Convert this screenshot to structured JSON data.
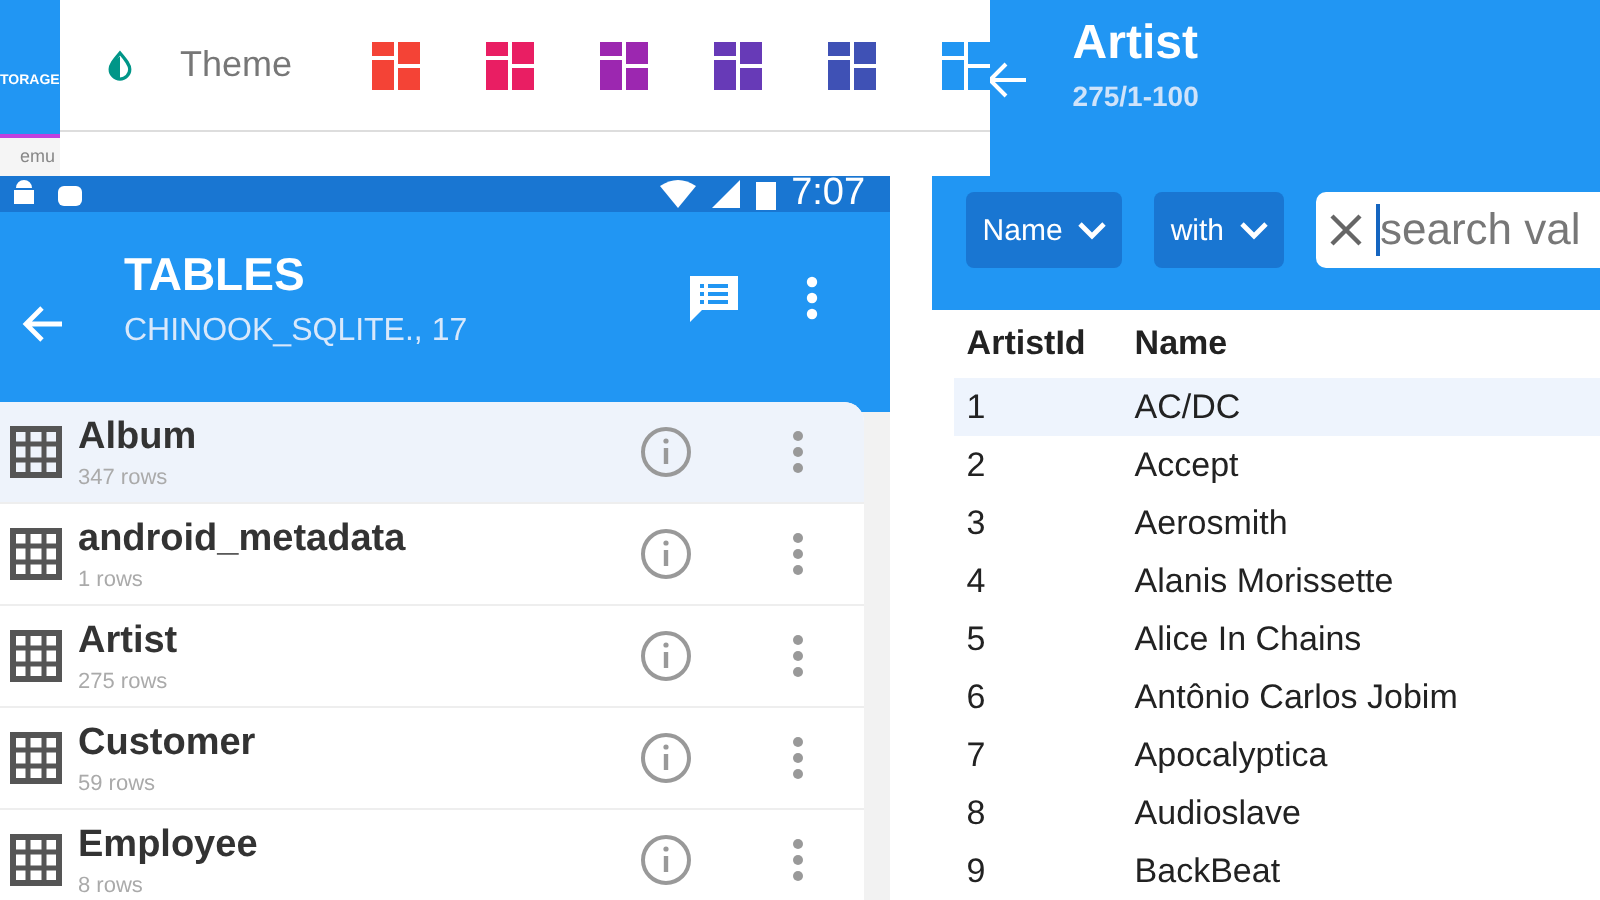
{
  "background_app": {
    "tab_label": "TORAGE",
    "path": "emu"
  },
  "theme_picker": {
    "label": "Theme",
    "swatches": [
      {
        "color": "#f44336"
      },
      {
        "color": "#e91e63"
      },
      {
        "color": "#9c27b0"
      },
      {
        "color": "#673ab7"
      },
      {
        "color": "#3f51b5"
      },
      {
        "color": "#2196f3"
      }
    ]
  },
  "status_bar": {
    "time": "7:07"
  },
  "tables_screen": {
    "title": "TABLES",
    "subtitle": "CHINOOK_SQLITE., 17",
    "items": [
      {
        "name": "Album",
        "rows": "347 rows",
        "selected": true
      },
      {
        "name": "android_metadata",
        "rows": "1 rows",
        "selected": false
      },
      {
        "name": "Artist",
        "rows": "275 rows",
        "selected": false
      },
      {
        "name": "Customer",
        "rows": "59 rows",
        "selected": false
      },
      {
        "name": "Employee",
        "rows": "8 rows",
        "selected": false
      }
    ]
  },
  "artist_screen": {
    "title": "Artist",
    "subtitle": "275/1-100",
    "column_filter": "Name",
    "operator_filter": "with",
    "search": {
      "placeholder": "search val"
    },
    "columns": [
      "ArtistId",
      "Name"
    ],
    "rows": [
      {
        "cells": [
          "1",
          "AC/DC"
        ],
        "selected": true
      },
      {
        "cells": [
          "2",
          "Accept"
        ],
        "selected": false
      },
      {
        "cells": [
          "3",
          "Aerosmith"
        ],
        "selected": false
      },
      {
        "cells": [
          "4",
          "Alanis Morissette"
        ],
        "selected": false
      },
      {
        "cells": [
          "5",
          "Alice In Chains"
        ],
        "selected": false
      },
      {
        "cells": [
          "6",
          "Antônio Carlos Jobim"
        ],
        "selected": false
      },
      {
        "cells": [
          "7",
          "Apocalyptica"
        ],
        "selected": false
      },
      {
        "cells": [
          "8",
          "Audioslave"
        ],
        "selected": false
      },
      {
        "cells": [
          "9",
          "BackBeat"
        ],
        "selected": false
      }
    ]
  }
}
